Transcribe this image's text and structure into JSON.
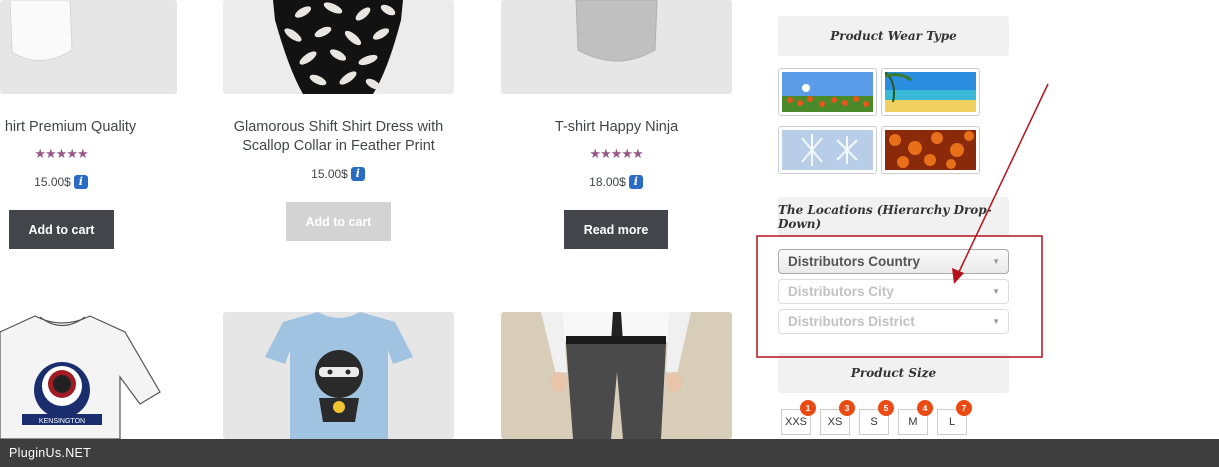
{
  "products": [
    {
      "title": "hirt Premium Quality",
      "rating": 4.5,
      "price": "15.00$",
      "button": "Add to cart"
    },
    {
      "title": "Glamorous Shift Shirt Dress with Scallop Collar in Feather Print",
      "price": "15.00$",
      "button": "Add to cart"
    },
    {
      "title": "T-shirt Happy Ninja",
      "rating": 5,
      "price": "18.00$",
      "button": "Read more"
    }
  ],
  "stars": {
    "product1": "★★★★★",
    "product3": "★★★★★"
  },
  "info_glyph": "i",
  "shirt_badge": {
    "ring_text": "",
    "bottom_text": "KENSINGTON"
  },
  "sidebar": {
    "wear_type": {
      "title": "Product Wear Type"
    },
    "locations": {
      "title": "The Locations (Hierarchy Drop-Down)",
      "selects": [
        "Distributors Country",
        "Distributors City",
        "Distributors District"
      ]
    },
    "size": {
      "title": "Product Size",
      "options": [
        {
          "label": "XXS",
          "count": "1"
        },
        {
          "label": "XS",
          "count": "3"
        },
        {
          "label": "S",
          "count": "5"
        },
        {
          "label": "M",
          "count": "4"
        },
        {
          "label": "L",
          "count": "7"
        }
      ]
    }
  },
  "colors": {
    "accent_purple": "#96588a",
    "annotation_red": "#b3131b",
    "footer_bg": "#3e3e3e"
  },
  "footer": {
    "text": "PluginUs.NET"
  }
}
